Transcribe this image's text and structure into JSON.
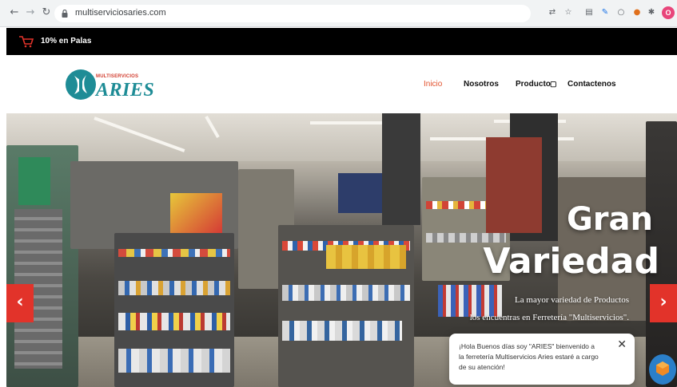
{
  "browser": {
    "url": "multiserviciosaries.com",
    "profile_initial": "O"
  },
  "promo": {
    "text": "10% en Palas"
  },
  "logo": {
    "small": "MULTISERVICIOS",
    "big": "ARIES"
  },
  "nav": {
    "items": [
      {
        "label": "Inicio"
      },
      {
        "label": "Nosotros"
      },
      {
        "label": "Producto"
      },
      {
        "label": "Contactenos"
      }
    ]
  },
  "hero": {
    "title_line1": "Gran",
    "title_line2": "Variedad",
    "sub_line1": "La mayor variedad de Productos",
    "sub_line2": "los encuentras en Ferretería \"Multiservicios\"."
  },
  "chat": {
    "message": "¡Hola Buenos días soy \"ARIES\" bienvenido a la ferretería Multiservicios Aries estaré a cargo de su atención!",
    "close": "✕"
  },
  "colors": {
    "accent": "#e2512c",
    "brand": "#1e8c96",
    "arrow": "#e2332a"
  }
}
